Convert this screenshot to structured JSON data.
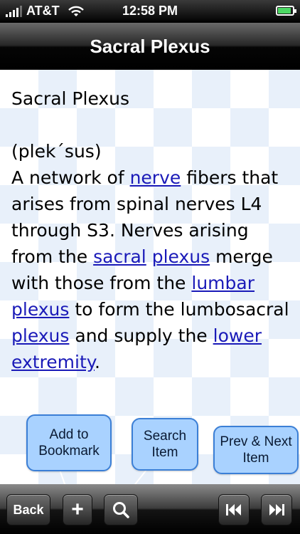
{
  "status": {
    "carrier": "AT&T",
    "time": "12:58 PM",
    "battery_level": 0.9
  },
  "nav": {
    "title": "Sacral Plexus"
  },
  "entry": {
    "heading": "Sacral Plexus",
    "pronunciation": "(plek´sus)",
    "def": {
      "t1": "A network of ",
      "link_nerve": "nerve",
      "t2": " fibers that arises from spinal nerves L4 through S3. Nerves arising from the ",
      "link_sacral": "sacral",
      "t3": " ",
      "link_plexus1": "plexus",
      "t4": " merge with those from the ",
      "link_lumbar": "lumbar",
      "t5": " ",
      "link_plexus2": "plexus",
      "t6": " to form the lumbosacral ",
      "link_plexus3": "plexus",
      "t7": " and supply the ",
      "link_lower": "lower extremity",
      "t8": "."
    }
  },
  "callouts": {
    "bookmark": "Add to\nBookmark",
    "search": "Search\nItem",
    "prevnext": "Prev & Next\nItem"
  },
  "toolbar": {
    "back_label": "Back",
    "add_glyph": "+",
    "search_glyph": "⌕",
    "prev_glyph": "⏮",
    "next_glyph": "⏭"
  }
}
